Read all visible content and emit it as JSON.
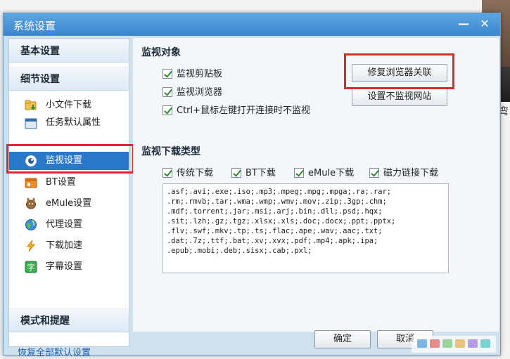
{
  "window": {
    "title": "系统设置",
    "minimize_glyph": "—",
    "close_glyph": "✕"
  },
  "sidebar": {
    "basic_settings": "基本设置",
    "detail_settings": "细节设置",
    "items": [
      {
        "label": "小文件下载",
        "icon": "folder-download-icon"
      },
      {
        "label": "任务默认属性",
        "icon": "task-properties-icon"
      },
      {
        "label": "监视设置",
        "icon": "monitor-eye-icon",
        "selected": true
      },
      {
        "label": "BT设置",
        "icon": "bt-box-icon"
      },
      {
        "label": "eMule设置",
        "icon": "emule-mule-icon"
      },
      {
        "label": "代理设置",
        "icon": "proxy-globe-icon"
      },
      {
        "label": "下载加速",
        "icon": "lightning-icon"
      },
      {
        "label": "字幕设置",
        "icon": "subtitle-icon"
      }
    ],
    "mode_reminder": "模式和提醒",
    "restore_defaults": "恢复全部默认设置"
  },
  "monitor_objects": {
    "title": "监视对象",
    "options": [
      {
        "label": "监视剪贴板",
        "checked": true
      },
      {
        "label": "监视浏览器",
        "checked": true
      },
      {
        "label": "Ctrl+鼠标左键打开连接时不监视",
        "checked": true
      }
    ],
    "repair_browser_button": "修复浏览器关联",
    "exclude_sites_button": "设置不监视网站"
  },
  "monitor_download_types": {
    "title": "监视下载类型",
    "options": [
      {
        "label": "传统下载",
        "checked": true
      },
      {
        "label": "BT下载",
        "checked": true
      },
      {
        "label": "eMule下载",
        "checked": true
      },
      {
        "label": "磁力链接下载",
        "checked": true
      }
    ],
    "extensions": ".asf;.avi;.exe;.iso;.mp3;.mpeg;.mpg;.mpga;.ra;.rar;\n.rm;.rmvb;.tar;.wma;.wmp;.wmv;.mov;.zip;.3gp;.chm;\n.mdf;.torrent;.jar;.msi;.arj;.bin;.dll;.psd;.hqx;\n.sit;.lzh;.gz;.tgz;.xlsx;.xls;.doc;.docx;.ppt;.pptx;\n.flv;.swf;.mkv;.tp;.ts;.flac;.ape;.wav;.aac;.txt;\n.dat;.7z;.ttf;.bat;.xv;.xvx;.pdf;.mp4;.apk;.ipa;\n.epub;.mobi;.deb;.sisx;.cab;.pxl;"
  },
  "footer": {
    "ok": "确定",
    "cancel": "取消"
  },
  "background": {
    "edge_char": "弯"
  },
  "colors": {
    "title_bar": "#3a86cf",
    "selected_item": "#2b78c8",
    "highlight": "#e0292a",
    "link": "#1f62b3"
  }
}
